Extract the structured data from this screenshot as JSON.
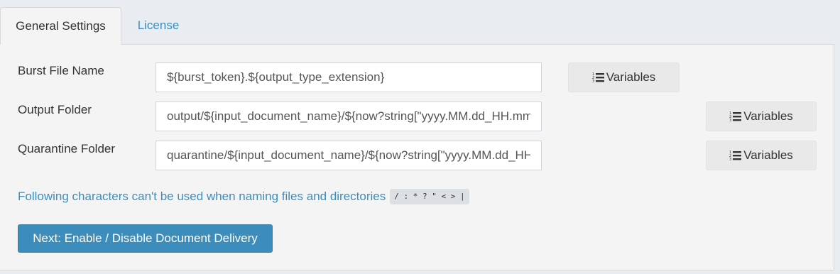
{
  "tabs": [
    {
      "label": "General Settings",
      "active": true
    },
    {
      "label": "License",
      "active": false
    }
  ],
  "settings": {
    "burst_file_name": {
      "label": "Burst File Name",
      "value": "${burst_token}.${output_type_extension}"
    },
    "output_folder": {
      "label": "Output Folder",
      "value": "output/${input_document_name}/${now?string[\"yyyy.MM.dd_HH.mm.ss\"]}"
    },
    "quarantine_folder": {
      "label": "Quarantine Folder",
      "value": "quarantine/${input_document_name}/${now?string[\"yyyy.MM.dd_HH.mm.ss\"]}"
    }
  },
  "variables_button_label": "Variables",
  "variables_icon": "list-ol-icon",
  "note": {
    "text": "Following characters can't be used when naming files and directories",
    "forbidden_chars": "/ : * ? \" < > |"
  },
  "next_button_label": "Next: Enable / Disable Document Delivery",
  "colors": {
    "accent": "#3c8dbc",
    "panel_bg": "#f4f4f4",
    "page_bg": "#e9ecf0",
    "button_bg": "#e9e9e9"
  }
}
